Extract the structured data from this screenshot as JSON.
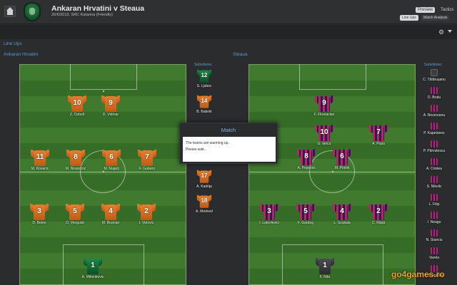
{
  "header": {
    "title": "Ankaran Hrvatini v Steaua",
    "subtitle": "26/6/2013, SRC Katarina (Friendly)",
    "tabs": {
      "preview": "Preview",
      "tactics": "Tactics"
    },
    "subtabs": {
      "lineups": "Line Ups",
      "analysis": "Match Analysis"
    }
  },
  "section_title": "Line Ups",
  "home": {
    "name": "Ankaran Hrvatini",
    "players": [
      {
        "num": "10",
        "name": "Z. Ozbolt"
      },
      {
        "num": "9",
        "name": "D. Vidmar"
      },
      {
        "num": "11",
        "name": "M. Kovacic"
      },
      {
        "num": "8",
        "name": "M. Nisandzic"
      },
      {
        "num": "6",
        "name": "M. Nagelj"
      },
      {
        "num": "7",
        "name": "F. Gabero"
      },
      {
        "num": "3",
        "name": "D. Belen"
      },
      {
        "num": "5",
        "name": "D. Venguist"
      },
      {
        "num": "4",
        "name": "M. Bruman"
      },
      {
        "num": "2",
        "name": "I. Vidovic"
      },
      {
        "num": "1",
        "name": "A. Mikenkovic"
      }
    ],
    "subs_label": "Substitutes",
    "subs": [
      {
        "num": "12",
        "name": "S. Ljubec"
      },
      {
        "num": "14",
        "name": "B. Babnik"
      },
      {
        "num": "17",
        "name": "A. Kadrija"
      },
      {
        "num": "18",
        "name": "A. Medved"
      }
    ]
  },
  "away": {
    "name": "Steaua",
    "players": [
      {
        "num": "9",
        "name": "F. Floreaciari"
      },
      {
        "num": "10",
        "name": "G. Iancu"
      },
      {
        "num": "7",
        "name": "A. Popa"
      },
      {
        "num": "8",
        "name": "A. Popovici"
      },
      {
        "num": "6",
        "name": "M. Pintilii"
      },
      {
        "num": "3",
        "name": "I. Latovlevici"
      },
      {
        "num": "5",
        "name": "F. Gardog"
      },
      {
        "num": "4",
        "name": "L. Szukala"
      },
      {
        "num": "2",
        "name": "C. Răpă"
      },
      {
        "num": "1",
        "name": "F. Nita"
      }
    ],
    "subs_label": "Substitutes",
    "subs": [
      "C. Tătărușanu",
      "D. Bratu",
      "A. Bourceanu",
      "P. Kapetanos",
      "P. Pârvulescu",
      "A. Cristea",
      "S. Nikolic",
      "L. Filip",
      "I. Neagu",
      "N. Stanciu",
      "Varela",
      "I. Prepelita"
    ]
  },
  "modal": {
    "title": "Match",
    "line1": "The teams are warming up.",
    "line2": "Please wait..."
  },
  "watermark": "go4games.ro",
  "icons": [
    "home-icon",
    "club-crest",
    "gear-icon"
  ]
}
